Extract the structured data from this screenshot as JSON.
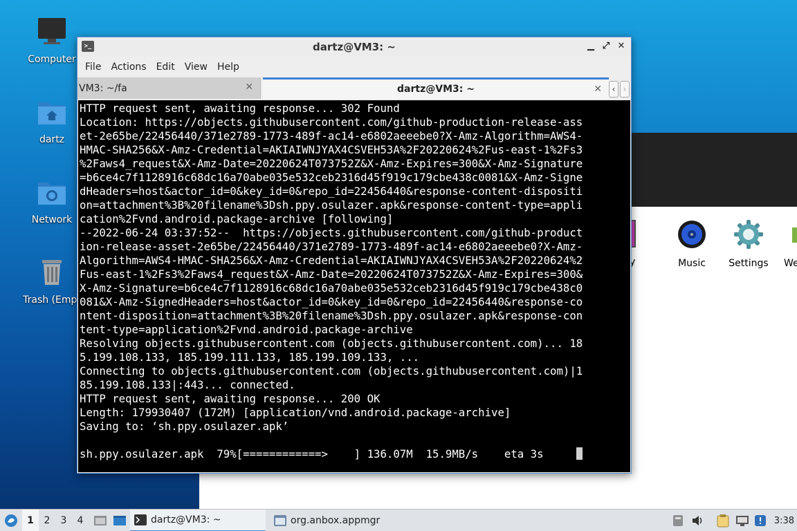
{
  "desktop": {
    "icons": [
      {
        "label": "Computer",
        "icon": "monitor-icon"
      },
      {
        "label": "dartz",
        "icon": "home-folder-icon"
      },
      {
        "label": "Network",
        "icon": "network-folder-icon"
      },
      {
        "label": "Trash (Empt",
        "icon": "trash-icon"
      }
    ]
  },
  "anbox": {
    "apps": [
      {
        "label": "llery",
        "icon": "gallery-icon"
      },
      {
        "label": "Music",
        "icon": "music-icon"
      },
      {
        "label": "Settings",
        "icon": "settings-gear-icon"
      },
      {
        "label": "We",
        "icon": "app-icon"
      }
    ]
  },
  "terminal": {
    "title": "dartz@VM3: ~",
    "menu": [
      "File",
      "Actions",
      "Edit",
      "View",
      "Help"
    ],
    "tabs": [
      {
        "label": "VM3: ~/fa",
        "active": false
      },
      {
        "label": "dartz@VM3: ~",
        "active": true
      }
    ],
    "lines": [
      "HTTP request sent, awaiting response... 302 Found",
      "Location: https://objects.githubusercontent.com/github-production-release-ass",
      "et-2e65be/22456440/371e2789-1773-489f-ac14-e6802aeeebe0?X-Amz-Algorithm=AWS4-",
      "HMAC-SHA256&X-Amz-Credential=AKIAIWNJYAX4CSVEH53A%2F20220624%2Fus-east-1%2Fs3",
      "%2Faws4_request&X-Amz-Date=20220624T073752Z&X-Amz-Expires=300&X-Amz-Signature",
      "=b6ce4c7f1128916c68dc16a70abe035e532ceb2316d45f919c179cbe438c0081&X-Amz-Signe",
      "dHeaders=host&actor_id=0&key_id=0&repo_id=22456440&response-content-dispositi",
      "on=attachment%3B%20filename%3Dsh.ppy.osulazer.apk&response-content-type=appli",
      "cation%2Fvnd.android.package-archive [following]",
      "--2022-06-24 03:37:52--  https://objects.githubusercontent.com/github-product",
      "ion-release-asset-2e65be/22456440/371e2789-1773-489f-ac14-e6802aeeebe0?X-Amz-",
      "Algorithm=AWS4-HMAC-SHA256&X-Amz-Credential=AKIAIWNJYAX4CSVEH53A%2F20220624%2",
      "Fus-east-1%2Fs3%2Faws4_request&X-Amz-Date=20220624T073752Z&X-Amz-Expires=300&",
      "X-Amz-Signature=b6ce4c7f1128916c68dc16a70abe035e532ceb2316d45f919c179cbe438c0",
      "081&X-Amz-SignedHeaders=host&actor_id=0&key_id=0&repo_id=22456440&response-co",
      "ntent-disposition=attachment%3B%20filename%3Dsh.ppy.osulazer.apk&response-con",
      "tent-type=application%2Fvnd.android.package-archive",
      "Resolving objects.githubusercontent.com (objects.githubusercontent.com)... 18",
      "5.199.108.133, 185.199.111.133, 185.199.109.133, ...",
      "Connecting to objects.githubusercontent.com (objects.githubusercontent.com)|1",
      "85.199.108.133|:443... connected.",
      "HTTP request sent, awaiting response... 200 OK",
      "Length: 179930407 (172M) [application/vnd.android.package-archive]",
      "Saving to: ‘sh.ppy.osulazer.apk’",
      "",
      "sh.ppy.osulazer.apk  79%[============>    ] 136.07M  15.9MB/s    eta 3s     "
    ]
  },
  "taskbar": {
    "workspaces": [
      "1",
      "2",
      "3",
      "4"
    ],
    "tasks": [
      {
        "label": "dartz@VM3: ~",
        "active": true
      },
      {
        "label": "org.anbox.appmgr",
        "active": false
      }
    ],
    "clock": "3:38"
  }
}
